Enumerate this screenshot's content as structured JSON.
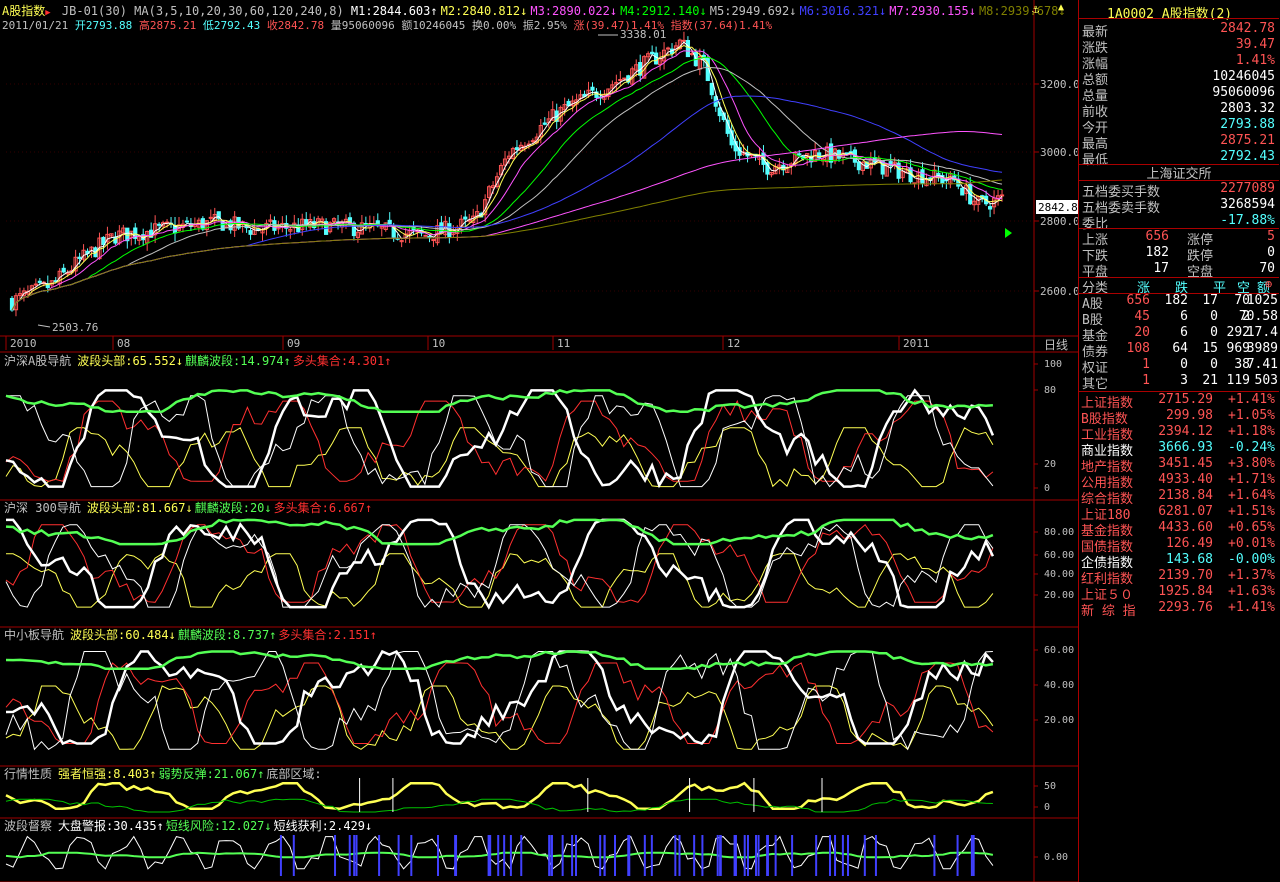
{
  "header": {
    "title": "A股指数",
    "title_arrow": "▶",
    "formula": "JB-01(30)",
    "ma_params": "MA(3,5,10,20,30,60,120,240,8)",
    "ma": [
      {
        "label": "M1:2844.603",
        "arrow": "↑",
        "color": "#ffffff"
      },
      {
        "label": "M2:2840.812",
        "arrow": "↓",
        "color": "#ffff54"
      },
      {
        "label": "M3:2890.022",
        "arrow": "↓",
        "color": "#ff54ff"
      },
      {
        "label": "M4:2912.140",
        "arrow": "↓",
        "color": "#00ff00"
      },
      {
        "label": "M5:2949.692",
        "arrow": "↓",
        "color": "#c0c0c0"
      },
      {
        "label": "M6:3016.321",
        "arrow": "↓",
        "color": "#4040ff"
      },
      {
        "label": "M7:2930.155",
        "arrow": "↓",
        "color": "#ff54ff"
      },
      {
        "label": "M8:2939.678",
        "arrow": "↓",
        "color": "#808000"
      }
    ],
    "date": "2011/01/21",
    "open": "开2793.88",
    "high": "高2875.21",
    "low": "低2792.43",
    "close": "收2842.78",
    "volume": "量95060096",
    "amount": "额10246045",
    "turnover": "换0.00%",
    "amplitude": "振2.95%",
    "change": "涨(39.47)1.41%",
    "index_change": "指数(37.64)1.41%"
  },
  "price_axis": {
    "labels": [
      "3200.0",
      "3000.0",
      "2800.0",
      "2600.0"
    ],
    "current": "2842.8",
    "peak_label": "3338.01",
    "trough_label": "2503.76"
  },
  "date_axis": {
    "labels": [
      "2010",
      "08",
      "09",
      "10",
      "11",
      "12",
      "2011"
    ],
    "period": "日线"
  },
  "panels": [
    {
      "id": "p1",
      "title": "沪深A股导航",
      "items": [
        {
          "text": "波段头部:65.552",
          "arrow": "↓",
          "color": "#ffff54"
        },
        {
          "text": "麒麟波段:14.974",
          "arrow": "↑",
          "color": "#54ff54"
        },
        {
          "text": "多头集合:4.301",
          "arrow": "↑",
          "color": "#ff3030"
        }
      ],
      "axis": [
        "100",
        "80",
        "20",
        "0"
      ]
    },
    {
      "id": "p2",
      "title": "沪深 300导航",
      "items": [
        {
          "text": "波段头部:81.667",
          "arrow": "↓",
          "color": "#ffff54"
        },
        {
          "text": "麒麟波段:20",
          "arrow": "↓",
          "color": "#54ff54"
        },
        {
          "text": "多头集合:6.667",
          "arrow": "↑",
          "color": "#ff3030"
        }
      ],
      "axis": [
        "80.00",
        "60.00",
        "40.00",
        "20.00"
      ]
    },
    {
      "id": "p3",
      "title": "中小板导航",
      "items": [
        {
          "text": "波段头部:60.484",
          "arrow": "↓",
          "color": "#ffff54"
        },
        {
          "text": "麒麟波段:8.737",
          "arrow": "↑",
          "color": "#54ff54"
        },
        {
          "text": "多头集合:2.151",
          "arrow": "↑",
          "color": "#ff3030"
        }
      ],
      "axis": [
        "60.00",
        "40.00",
        "20.00"
      ]
    },
    {
      "id": "p4",
      "title": "行情性质",
      "items": [
        {
          "text": "强者恒强:8.403",
          "arrow": "↑",
          "color": "#ffff54"
        },
        {
          "text": "弱势反弹:21.067",
          "arrow": "↑",
          "color": "#54ff54"
        },
        {
          "text": "底部区域:",
          "arrow": "",
          "color": "#c0c0c0"
        }
      ],
      "axis": [
        "50",
        "0"
      ]
    },
    {
      "id": "p5",
      "title": "波段督察",
      "items": [
        {
          "text": "大盘警报:30.435",
          "arrow": "↑",
          "color": "#ffffff"
        },
        {
          "text": "短线风险:12.027",
          "arrow": "↓",
          "color": "#54ff54"
        },
        {
          "text": "短线获利:2.429",
          "arrow": "↓",
          "color": "#ffffff"
        }
      ],
      "axis": [
        "0.00"
      ]
    }
  ],
  "sidebar": {
    "code": "1A0002",
    "name": "A股指数",
    "name_suffix": "(2)",
    "quote": [
      {
        "k": "最新",
        "v": "2842.78",
        "c": "#ff5454"
      },
      {
        "k": "涨跌",
        "v": "39.47",
        "c": "#ff5454"
      },
      {
        "k": "涨幅",
        "v": "1.41%",
        "c": "#ff5454"
      },
      {
        "k": "总额",
        "v": "10246045",
        "c": "#ffffff"
      },
      {
        "k": "总量",
        "v": "95060096",
        "c": "#ffffff"
      },
      {
        "k": "前收",
        "v": "2803.32",
        "c": "#ffffff"
      },
      {
        "k": "今开",
        "v": "2793.88",
        "c": "#54ffff"
      },
      {
        "k": "最高",
        "v": "2875.21",
        "c": "#ff5454"
      },
      {
        "k": "最低",
        "v": "2792.43",
        "c": "#54ffff"
      }
    ],
    "exchange": "上海证交所",
    "orders": [
      {
        "k": "五档委买手数",
        "v": "2277089",
        "c": "#ff5454"
      },
      {
        "k": "五档委卖手数",
        "v": "3268594",
        "c": "#ffffff"
      },
      {
        "k": "委比",
        "v": "-17.88%",
        "c": "#54ffff"
      }
    ],
    "breadth": [
      {
        "k1": "上涨",
        "v1": "656",
        "c1": "#ff5454",
        "k2": "涨停",
        "v2": "5",
        "c2": "#ff5454"
      },
      {
        "k1": "下跌",
        "v1": "182",
        "c1": "#ffffff",
        "k2": "跌停",
        "v2": "0",
        "c2": "#ffffff"
      },
      {
        "k1": "平盘",
        "v1": "17",
        "c1": "#ffffff",
        "k2": "空盘",
        "v2": "70",
        "c2": "#ffffff"
      }
    ],
    "cat_header": [
      "分类",
      "涨",
      "跌",
      "平",
      "空",
      "额"
    ],
    "cat_plus": "⊕",
    "categories": [
      {
        "name": "A股",
        "up": "656",
        "down": "182",
        "flat": "17",
        "empty": "70",
        "amt": "1025"
      },
      {
        "name": "B股",
        "up": "45",
        "down": "6",
        "flat": "0",
        "empty": "2",
        "amt": "70.58"
      },
      {
        "name": "基金",
        "up": "20",
        "down": "6",
        "flat": "0",
        "empty": "292",
        "amt": "17.4"
      },
      {
        "name": "债券",
        "up": "108",
        "down": "64",
        "flat": "15",
        "empty": "969",
        "amt": "3989"
      },
      {
        "name": "权证",
        "up": "1",
        "down": "0",
        "flat": "0",
        "empty": "38",
        "amt": "7.41"
      },
      {
        "name": "其它",
        "up": "1",
        "down": "3",
        "flat": "21",
        "empty": "119",
        "amt": "503"
      }
    ],
    "indices": [
      {
        "name": "上证指数",
        "value": "2715.29",
        "change": "+1.41%",
        "nc": "#ff5454",
        "vc": "#ff5454"
      },
      {
        "name": "B股指数",
        "value": "299.98",
        "change": "+1.05%",
        "nc": "#ff5454",
        "vc": "#ff5454"
      },
      {
        "name": "工业指数",
        "value": "2394.12",
        "change": "+1.18%",
        "nc": "#ff5454",
        "vc": "#ff5454"
      },
      {
        "name": "商业指数",
        "value": "3666.93",
        "change": "-0.24%",
        "nc": "#ffffff",
        "vc": "#54ffff"
      },
      {
        "name": "地产指数",
        "value": "3451.45",
        "change": "+3.80%",
        "nc": "#ff5454",
        "vc": "#ff5454"
      },
      {
        "name": "公用指数",
        "value": "4933.40",
        "change": "+1.71%",
        "nc": "#ff5454",
        "vc": "#ff5454"
      },
      {
        "name": "综合指数",
        "value": "2138.84",
        "change": "+1.64%",
        "nc": "#ff5454",
        "vc": "#ff5454"
      },
      {
        "name": "上证180",
        "value": "6281.07",
        "change": "+1.51%",
        "nc": "#ff5454",
        "vc": "#ff5454"
      },
      {
        "name": "基金指数",
        "value": "4433.60",
        "change": "+0.65%",
        "nc": "#ff5454",
        "vc": "#ff5454"
      },
      {
        "name": "国债指数",
        "value": "126.49",
        "change": "+0.01%",
        "nc": "#ff5454",
        "vc": "#ff5454"
      },
      {
        "name": "企债指数",
        "value": "143.68",
        "change": "-0.00%",
        "nc": "#ffffff",
        "vc": "#54ffff"
      },
      {
        "name": "红利指数",
        "value": "2139.70",
        "change": "+1.37%",
        "nc": "#ff5454",
        "vc": "#ff5454"
      },
      {
        "name": "上证５０",
        "value": "1925.84",
        "change": "+1.63%",
        "nc": "#ff5454",
        "vc": "#ff5454"
      },
      {
        "name": "新 综 指",
        "value": "2293.76",
        "change": "+1.41%",
        "nc": "#ff5454",
        "vc": "#ff5454"
      }
    ]
  },
  "colors": {
    "up": "#ff5454",
    "down": "#54ffff",
    "grid": "#a00000",
    "white": "#ffffff",
    "yellow": "#ffff54",
    "green": "#54ff54"
  }
}
